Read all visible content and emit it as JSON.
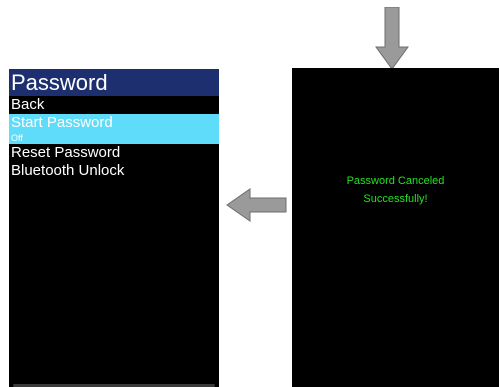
{
  "left_screen": {
    "title": "Password",
    "items": [
      {
        "label": "Back"
      },
      {
        "label": "Start Password",
        "sub": "Off",
        "selected": true
      },
      {
        "label": "Reset Password"
      },
      {
        "label": "Bluetooth Unlock"
      }
    ]
  },
  "right_screen": {
    "message_line1": "Password Canceled",
    "message_line2": "Successfully!"
  },
  "colors": {
    "title_bar": "#1d2f6f",
    "selected_item": "#5fdcf9",
    "status_text": "#21e321",
    "arrow": "#9a9a9a"
  },
  "icons": {
    "arrow_down": "arrow-down-icon",
    "arrow_left": "arrow-left-icon"
  }
}
